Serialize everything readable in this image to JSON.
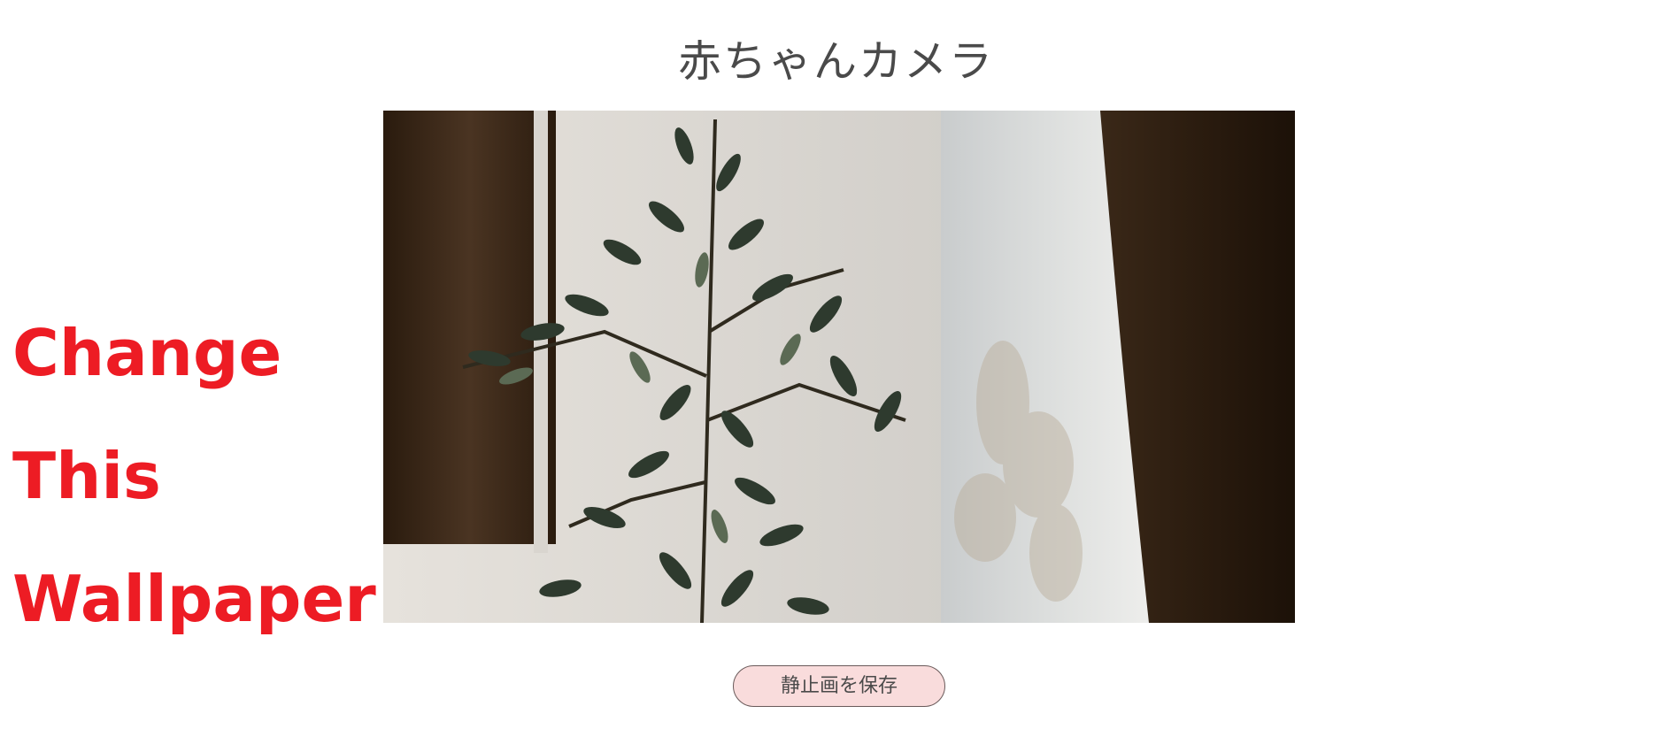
{
  "page": {
    "title": "赤ちゃんカメラ"
  },
  "wallpaper_notice": {
    "lines": [
      "Change",
      "This",
      "Wallpaper !"
    ],
    "color": "#ed1c24"
  },
  "camera": {
    "content": "camera-feed"
  },
  "save_button": {
    "label": "静止画を保存",
    "background": "#f9dcdc"
  }
}
